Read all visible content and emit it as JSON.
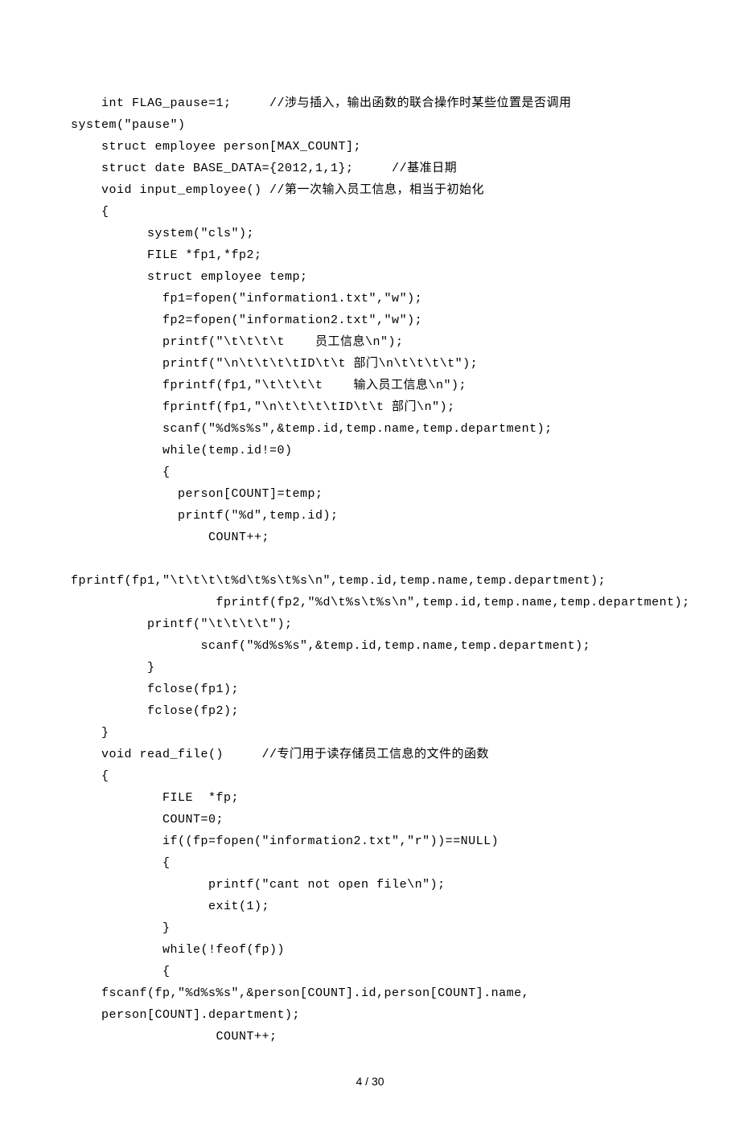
{
  "code_lines": [
    "    int FLAG_pause=1;     //涉与插入，输出函数的联合操作时某些位置是否调用",
    "system(\"pause\")",
    "    struct employee person[MAX_COUNT];",
    "    struct date BASE_DATA={2012,1,1};     //基准日期",
    "    void input_employee() //第一次输入员工信息，相当于初始化",
    "    {",
    "          system(\"cls\");",
    "          FILE *fp1,*fp2;",
    "          struct employee temp;",
    "            fp1=fopen(\"information1.txt\",\"w\");",
    "            fp2=fopen(\"information2.txt\",\"w\");",
    "            printf(\"\\t\\t\\t\\t    员工信息\\n\");",
    "            printf(\"\\n\\t\\t\\t\\tID\\t\\t 部门\\n\\t\\t\\t\\t\");",
    "            fprintf(fp1,\"\\t\\t\\t\\t    输入员工信息\\n\");",
    "            fprintf(fp1,\"\\n\\t\\t\\t\\tID\\t\\t 部门\\n\");",
    "            scanf(\"%d%s%s\",&temp.id,temp.name,temp.department);",
    "            while(temp.id!=0)",
    "            {",
    "              person[COUNT]=temp;",
    "              printf(\"%d\",temp.id);",
    "                  COUNT++;",
    "",
    "fprintf(fp1,\"\\t\\t\\t\\t%d\\t%s\\t%s\\n\",temp.id,temp.name,temp.department);",
    "                   fprintf(fp2,\"%d\\t%s\\t%s\\n\",temp.id,temp.name,temp.department);",
    "          printf(\"\\t\\t\\t\\t\");",
    "                 scanf(\"%d%s%s\",&temp.id,temp.name,temp.department);",
    "          }",
    "          fclose(fp1);",
    "          fclose(fp2);",
    "    }",
    "    void read_file()     //专门用于读存储员工信息的文件的函数",
    "    {",
    "            FILE  *fp;",
    "            COUNT=0;",
    "            if((fp=fopen(\"information2.txt\",\"r\"))==NULL)",
    "            {",
    "                  printf(\"cant not open file\\n\");",
    "                  exit(1);",
    "            }",
    "            while(!feof(fp))",
    "            {",
    "    fscanf(fp,\"%d%s%s\",&person[COUNT].id,person[COUNT].name,",
    "    person[COUNT].department);",
    "                   COUNT++;"
  ],
  "page_number": "4 / 30"
}
